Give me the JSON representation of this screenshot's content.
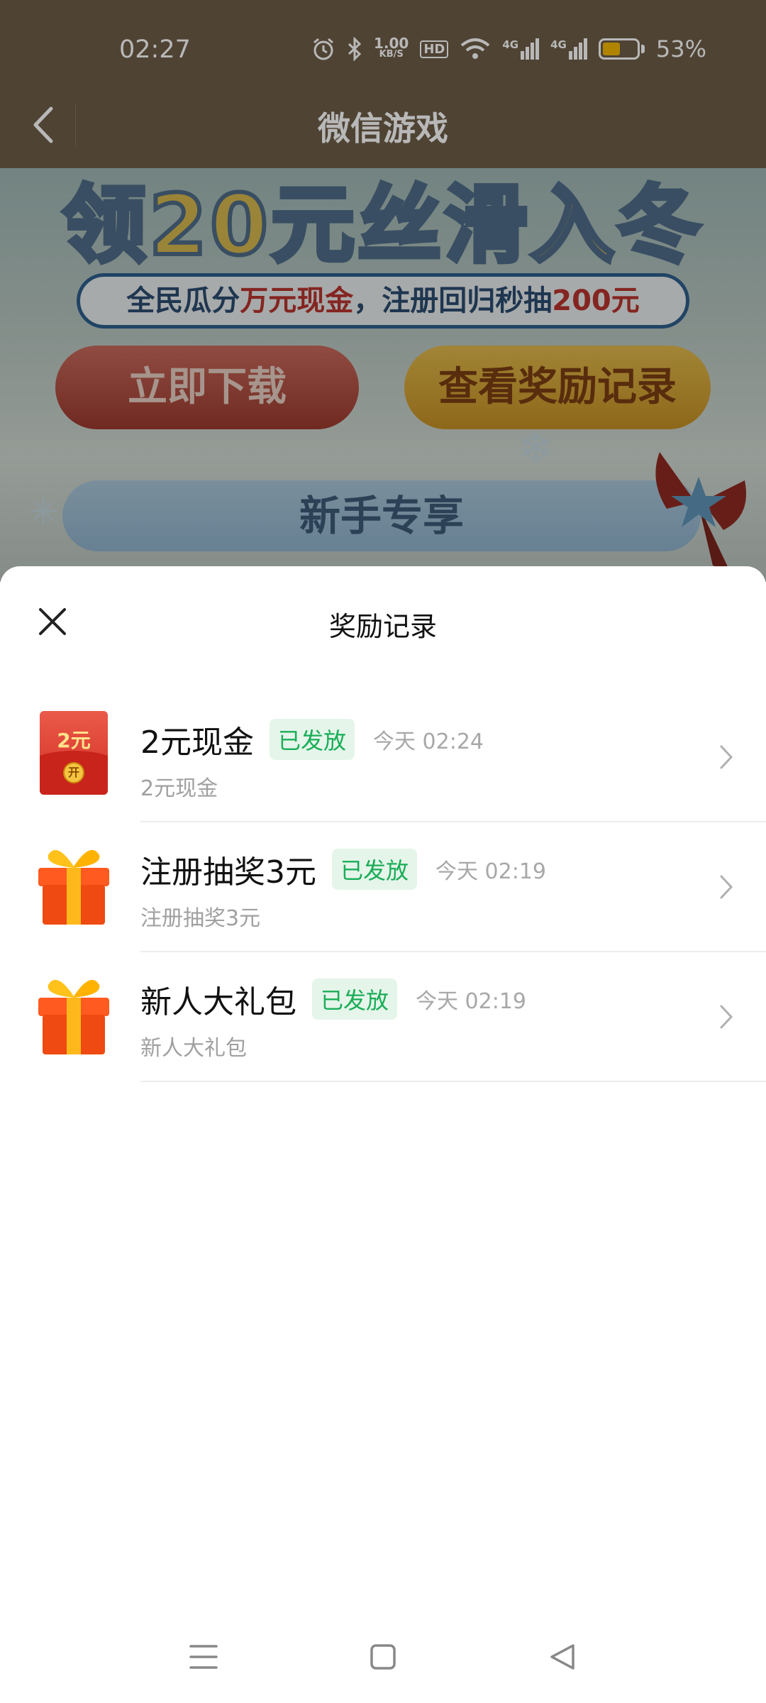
{
  "status_bar": {
    "time": "02:27",
    "net_speed_value": "1.00",
    "net_speed_unit": "KB/S",
    "hd_label": "HD",
    "signal1_label": "4G",
    "signal2_label": "4G",
    "battery_text": "53%",
    "battery_level": 0.53,
    "battery_color": "#f5b800",
    "icons": [
      "alarm-icon",
      "bluetooth-icon",
      "wifi-icon",
      "signal-icon",
      "battery-icon"
    ]
  },
  "nav": {
    "title": "微信游戏"
  },
  "banner": {
    "headline": "领20元丝滑入冬",
    "sub_prefix": "全民瓜分",
    "sub_red1": "万元现金",
    "sub_middle": "，注册回归秒抽",
    "sub_red2": "200元",
    "download_label": "立即下载",
    "records_label": "查看奖励记录",
    "newbie_label": "新手专享"
  },
  "sheet": {
    "title": "奖励记录",
    "items": [
      {
        "name": "2元现金",
        "status": "已发放",
        "time": "今天 02:24",
        "sub": "2元现金",
        "icon": "red-packet-icon",
        "icon_text": "2元",
        "icon_coin": "开"
      },
      {
        "name": "注册抽奖3元",
        "status": "已发放",
        "time": "今天 02:19",
        "sub": "注册抽奖3元",
        "icon": "gift-box-icon"
      },
      {
        "name": "新人大礼包",
        "status": "已发放",
        "time": "今天 02:19",
        "sub": "新人大礼包",
        "icon": "gift-box-icon"
      }
    ]
  },
  "colors": {
    "status_green": "#1aad57",
    "nav_bg": "#6e5e48"
  }
}
